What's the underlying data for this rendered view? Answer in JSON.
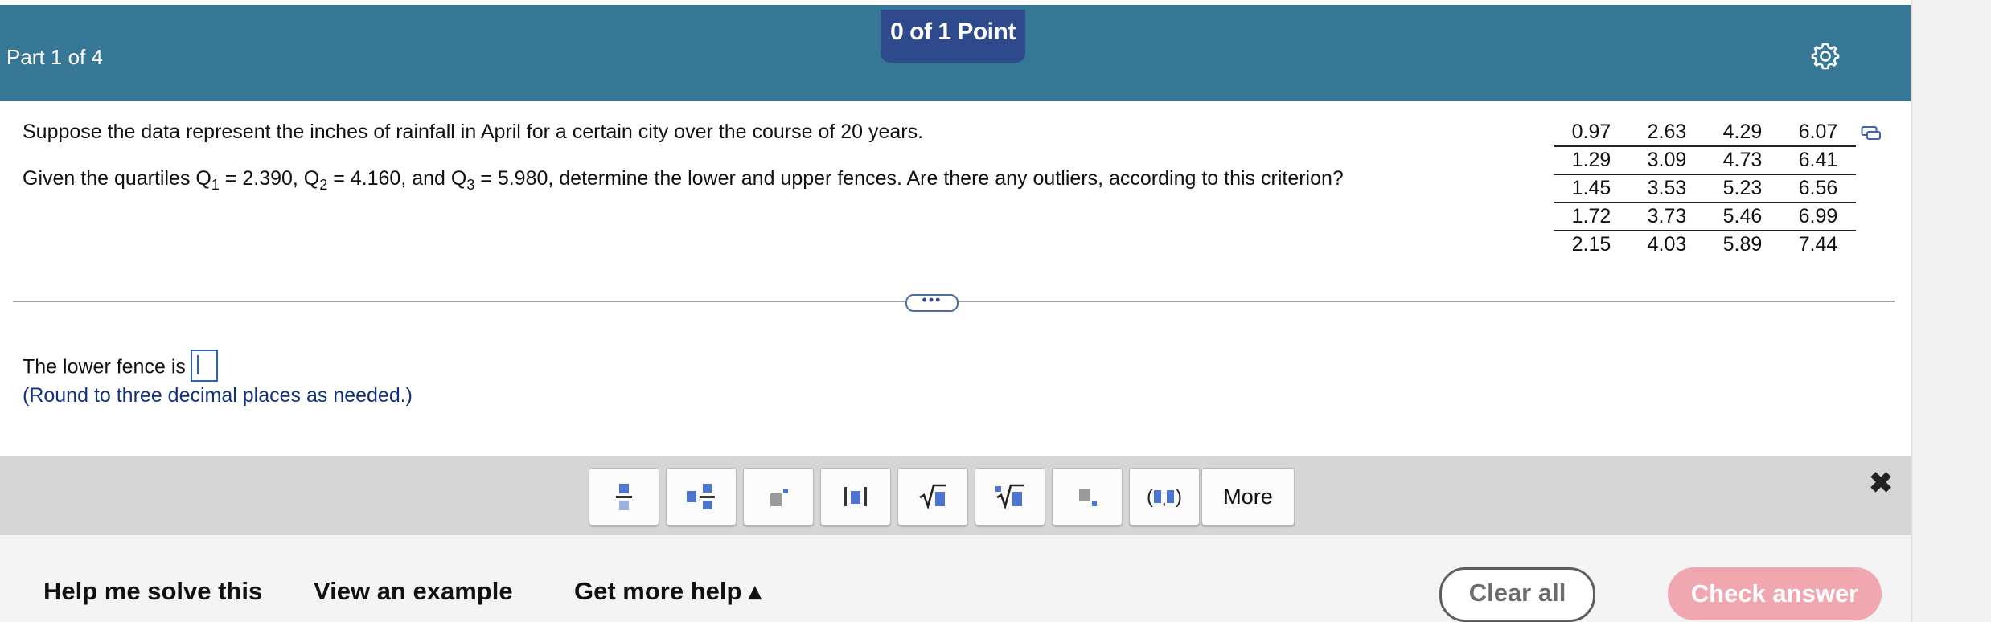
{
  "header": {
    "part_label": "Part 1 of 4",
    "points": "0 of 1 Point",
    "settings_icon": "gear-icon"
  },
  "question": {
    "line1": "Suppose the data represent the inches of rainfall in April for a certain city over the course of 20 years.",
    "line2_pre": "Given the quartiles Q",
    "q1_sub": "1",
    "q1_val": " = 2.390, Q",
    "q2_sub": "2",
    "q2_val": " = 4.160, and Q",
    "q3_sub": "3",
    "q3_val": " = 5.980, determine the lower and upper fences. Are there any outliers, according to this criterion?"
  },
  "data_table": {
    "rows": [
      [
        "0.97",
        "2.63",
        "4.29",
        "6.07"
      ],
      [
        "1.29",
        "3.09",
        "4.73",
        "6.41"
      ],
      [
        "1.45",
        "3.53",
        "5.23",
        "6.56"
      ],
      [
        "1.72",
        "3.73",
        "5.46",
        "6.99"
      ],
      [
        "2.15",
        "4.03",
        "5.89",
        "7.44"
      ]
    ],
    "copy_icon": "copy-icon"
  },
  "divider": {
    "expand_label": "•••"
  },
  "answer": {
    "prompt": "The lower fence is",
    "value": "",
    "note": "(Round to three decimal places as needed.)"
  },
  "palette": {
    "tools": [
      "fraction-icon",
      "mixed-number-icon",
      "exponent-icon",
      "absolute-value-icon",
      "square-root-icon",
      "nth-root-icon",
      "subscript-icon",
      "ordered-pair-icon"
    ],
    "more_label": "More",
    "close_label": "✖"
  },
  "footer": {
    "help_label": "Help me solve this",
    "example_label": "View an example",
    "more_help_label": "Get more help ▴",
    "clear_label": "Clear all",
    "check_label": "Check answer"
  },
  "colors": {
    "header_bg": "#367796",
    "badge_bg": "#2e4a8c",
    "note_text": "#13327d",
    "check_btn": "#f0a7b0",
    "palette_bg": "#d6d6d6"
  }
}
